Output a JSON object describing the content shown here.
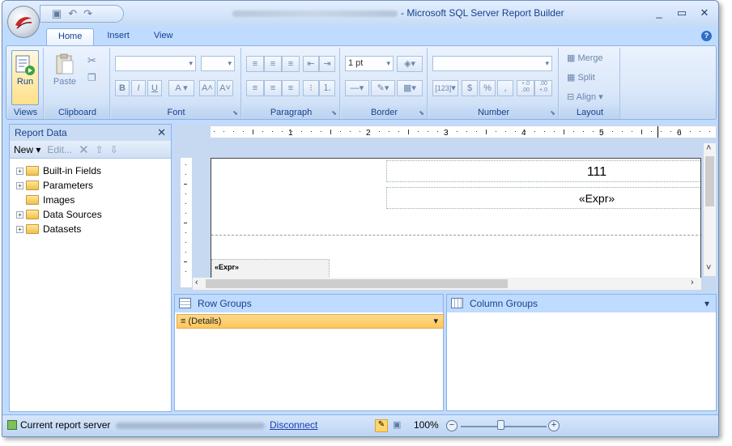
{
  "window": {
    "title": "- Microsoft SQL Server Report Builder",
    "controls": [
      "minimize-icon",
      "maximize-icon",
      "close-icon"
    ]
  },
  "colors": {
    "ribbon": "#dbe8fa",
    "accent": "#15428b",
    "selection": "#ffc75a",
    "frame": "#bfdbff"
  },
  "qat_icons": [
    "save-icon",
    "undo-icon",
    "redo-icon"
  ],
  "tabs": [
    "Home",
    "Insert",
    "View"
  ],
  "ribbon": {
    "views": {
      "run": "Run",
      "label": "Views"
    },
    "clipboard": {
      "paste": "Paste",
      "label": "Clipboard"
    },
    "font": {
      "label": "Font",
      "bold": "B",
      "italic": "I",
      "underline": "U",
      "color": "A",
      "grow": "A",
      "shrink": "A"
    },
    "paragraph": {
      "label": "Paragraph"
    },
    "border": {
      "label": "Border",
      "width": "1 pt"
    },
    "number": {
      "label": "Number",
      "placeholders": "[123]",
      "currency": "$",
      "percent": "%",
      "comma": ",",
      "inc_decimal": "+.0\n.00",
      "dec_decimal": ".00\n+.0"
    },
    "layout": {
      "label": "Layout",
      "merge": "Merge",
      "split": "Split",
      "align": "Align"
    }
  },
  "report_data": {
    "title": "Report Data",
    "toolbar": {
      "new": "New",
      "edit": "Edit..."
    },
    "items": [
      {
        "label": "Built-in Fields",
        "expandable": true
      },
      {
        "label": "Parameters",
        "expandable": true
      },
      {
        "label": "Images",
        "expandable": false
      },
      {
        "label": "Data Sources",
        "expandable": true
      },
      {
        "label": "Datasets",
        "expandable": true
      }
    ]
  },
  "ruler": {
    "marks": [
      "1",
      "2",
      "3",
      "4",
      "5",
      "6"
    ]
  },
  "canvas": {
    "textbox1": "111",
    "textbox2": "«Expr»",
    "textbox3": "«Expr»"
  },
  "groups": {
    "row_title": "Row Groups",
    "column_title": "Column Groups",
    "details": "≡ (Details)"
  },
  "status": {
    "server_label": "Current report server",
    "disconnect": "Disconnect",
    "zoom": "100%"
  }
}
